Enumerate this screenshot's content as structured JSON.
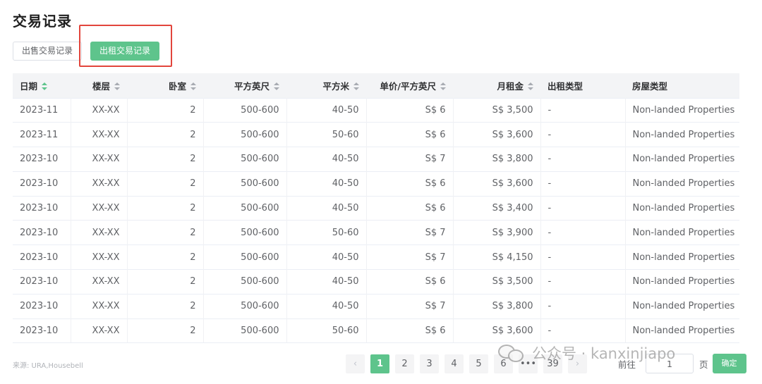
{
  "page": {
    "title": "交易记录"
  },
  "tabs": [
    {
      "label": "出售交易记录",
      "active": false
    },
    {
      "label": "出租交易记录",
      "active": true
    }
  ],
  "table": {
    "columns": [
      "日期",
      "楼层",
      "卧室",
      "平方英尺",
      "平方米",
      "单价/平方英尺",
      "月租金",
      "出租类型",
      "房屋类型"
    ],
    "rows": [
      [
        "2023-11",
        "XX-XX",
        "2",
        "500-600",
        "40-50",
        "S$ 6",
        "S$ 3,500",
        "-",
        "Non-landed Properties"
      ],
      [
        "2023-11",
        "XX-XX",
        "2",
        "500-600",
        "50-60",
        "S$ 6",
        "S$ 3,600",
        "-",
        "Non-landed Properties"
      ],
      [
        "2023-10",
        "XX-XX",
        "2",
        "500-600",
        "40-50",
        "S$ 7",
        "S$ 3,800",
        "-",
        "Non-landed Properties"
      ],
      [
        "2023-10",
        "XX-XX",
        "2",
        "500-600",
        "40-50",
        "S$ 6",
        "S$ 3,600",
        "-",
        "Non-landed Properties"
      ],
      [
        "2023-10",
        "XX-XX",
        "2",
        "500-600",
        "40-50",
        "S$ 6",
        "S$ 3,400",
        "-",
        "Non-landed Properties"
      ],
      [
        "2023-10",
        "XX-XX",
        "2",
        "500-600",
        "50-60",
        "S$ 7",
        "S$ 3,900",
        "-",
        "Non-landed Properties"
      ],
      [
        "2023-10",
        "XX-XX",
        "2",
        "500-600",
        "40-50",
        "S$ 7",
        "S$ 4,150",
        "-",
        "Non-landed Properties"
      ],
      [
        "2023-10",
        "XX-XX",
        "2",
        "500-600",
        "40-50",
        "S$ 6",
        "S$ 3,500",
        "-",
        "Non-landed Properties"
      ],
      [
        "2023-10",
        "XX-XX",
        "2",
        "500-600",
        "40-50",
        "S$ 7",
        "S$ 3,800",
        "-",
        "Non-landed Properties"
      ],
      [
        "2023-10",
        "XX-XX",
        "2",
        "500-600",
        "50-60",
        "S$ 6",
        "S$ 3,600",
        "-",
        "Non-landed Properties"
      ]
    ]
  },
  "source": "来源: URA,Housebell",
  "pagination": {
    "prev": "‹",
    "pages": [
      "1",
      "2",
      "3",
      "4",
      "5",
      "6",
      "•••",
      "39"
    ],
    "current": "1",
    "next": "›",
    "goto_label": "前往",
    "goto_value": "1",
    "goto_unit": "页",
    "confirm_label": "确定"
  },
  "watermark": "公众号 · kanxinjiapo",
  "colors": {
    "accent": "#5ec48c",
    "highlight": "#e2453c"
  }
}
